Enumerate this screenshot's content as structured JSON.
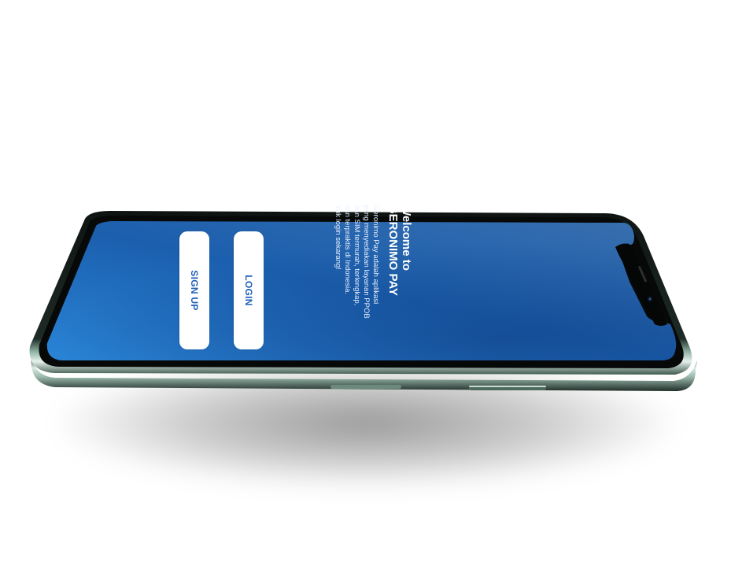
{
  "welcome": {
    "title": "Welcome to\nGERONIMO PAY",
    "description": "Geronimo Pay adalah aplikasi\nyang menyediakan layanan PPOB\ndan SIM termurah, terlengkap,\ndan terpraktis di Indonesia.\nYuk login sekarang!"
  },
  "buttons": {
    "login_label": "LOGIN",
    "signup_label": "SIGN UP"
  },
  "colors": {
    "screen_top": "#2f7fd0",
    "screen_bottom": "#123f86",
    "button_text": "#1d5fb8",
    "frame": "#4f6d63"
  }
}
